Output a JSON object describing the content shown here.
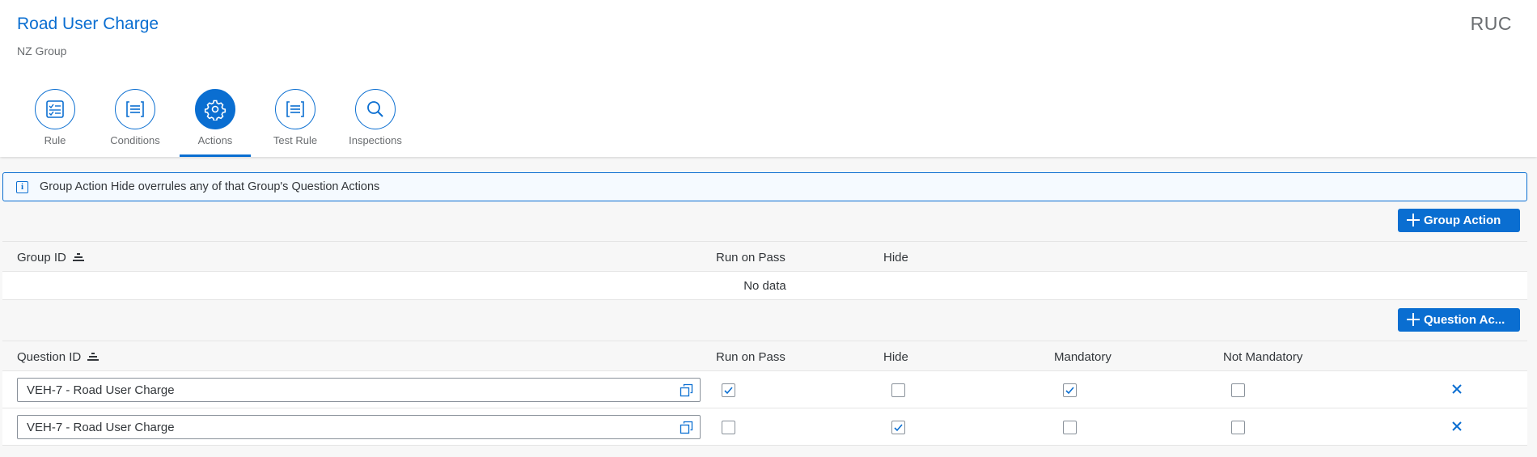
{
  "header": {
    "title": "Road User Charge",
    "subtitle": "NZ Group",
    "abbr": "RUC"
  },
  "tabs": [
    {
      "label": "Rule",
      "icon": "checklist-icon",
      "active": false
    },
    {
      "label": "Conditions",
      "icon": "list-bracket-icon",
      "active": false
    },
    {
      "label": "Actions",
      "icon": "gear-icon",
      "active": true
    },
    {
      "label": "Test Rule",
      "icon": "list-bracket-icon",
      "active": false
    },
    {
      "label": "Inspections",
      "icon": "search-icon",
      "active": false
    }
  ],
  "info": {
    "icon": "info-icon",
    "text": "Group Action Hide overrules any of that Group's Question Actions"
  },
  "group_actions": {
    "add_button": "Group Action",
    "columns": [
      "Group ID",
      "Run on Pass",
      "Hide"
    ],
    "no_data": "No data"
  },
  "question_actions": {
    "add_button": "Question Ac...",
    "columns": [
      "Question ID",
      "Run on Pass",
      "Hide",
      "Mandatory",
      "Not Mandatory"
    ],
    "rows": [
      {
        "question_id": "VEH-7 - Road User Charge",
        "run_on_pass": true,
        "hide": false,
        "mandatory": true,
        "not_mandatory": false
      },
      {
        "question_id": "VEH-7 - Road User Charge",
        "run_on_pass": false,
        "hide": true,
        "mandatory": false,
        "not_mandatory": false
      }
    ]
  },
  "colors": {
    "accent": "#0a6ed1",
    "title": "#0a6ed1",
    "background": "#f7f7f7"
  }
}
